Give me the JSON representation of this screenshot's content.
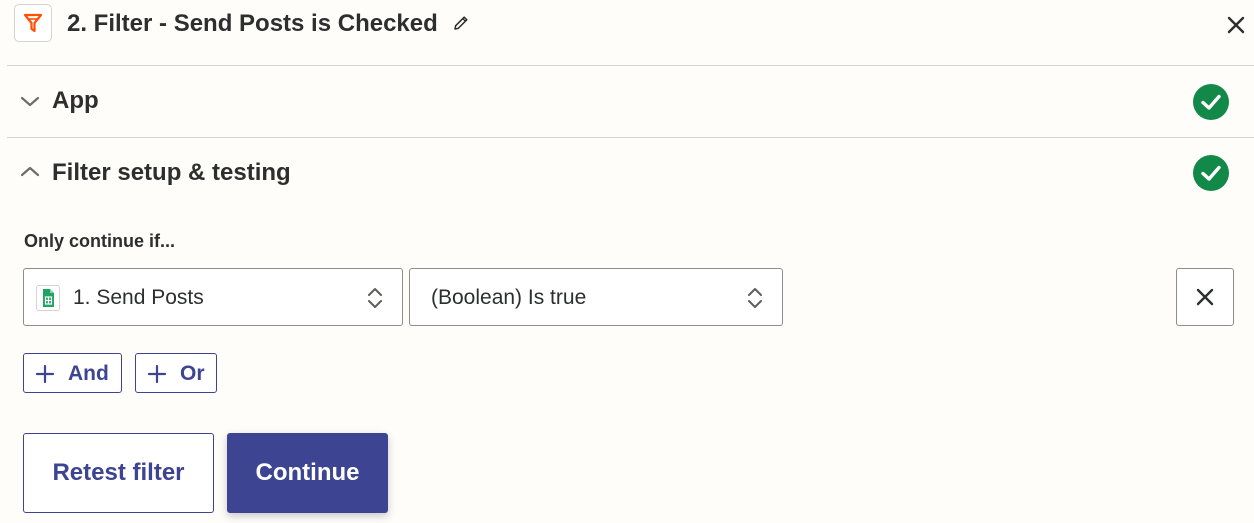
{
  "header": {
    "title": "2. Filter - Send Posts is Checked",
    "app_icon": "filter-icon",
    "edit_icon": "pencil-icon",
    "close_icon": "close-icon"
  },
  "sections": [
    {
      "label": "App",
      "expanded": false,
      "status": "complete"
    },
    {
      "label": "Filter setup & testing",
      "expanded": true,
      "status": "complete"
    }
  ],
  "filter": {
    "intro": "Only continue if...",
    "condition": {
      "field": "1. Send Posts",
      "field_icon": "google-sheets-icon",
      "operator": "(Boolean) Is true"
    },
    "add_and_label": "And",
    "add_or_label": "Or"
  },
  "actions": {
    "retest_label": "Retest filter",
    "continue_label": "Continue"
  },
  "colors": {
    "accent": "#3d4592",
    "success": "#128849",
    "brand_orange": "#ff4f00",
    "sheets_green": "#1fa463"
  }
}
